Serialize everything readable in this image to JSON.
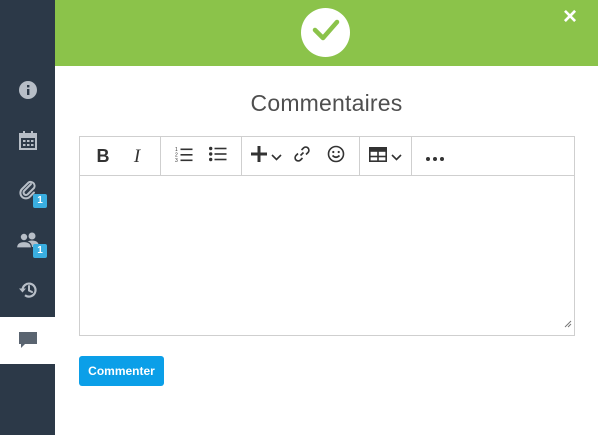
{
  "header": {
    "status_icon": "checkmark-icon",
    "close_label": "×",
    "background": "#8bc34a"
  },
  "sidebar": {
    "items": [
      {
        "icon": "info-icon",
        "badge": ""
      },
      {
        "icon": "calendar-icon",
        "badge": ""
      },
      {
        "icon": "paperclip-icon",
        "badge": "1"
      },
      {
        "icon": "users-icon",
        "badge": "1"
      },
      {
        "icon": "history-icon",
        "badge": ""
      },
      {
        "icon": "comment-icon",
        "badge": "",
        "active": true
      }
    ],
    "background": "#2c3948",
    "badge_color": "#3aaee0"
  },
  "main": {
    "title": "Commentaires",
    "editor": {
      "toolbar": {
        "bold_label": "B",
        "italic_label": "I",
        "icons": [
          "bold-icon",
          "italic-icon",
          "ordered-list-icon",
          "bullet-list-icon",
          "insert-plus-icon",
          "link-icon",
          "emoji-icon",
          "table-icon",
          "more-icon"
        ]
      },
      "content": ""
    },
    "submit_label": "Commenter",
    "submit_color": "#0b9fe8"
  }
}
